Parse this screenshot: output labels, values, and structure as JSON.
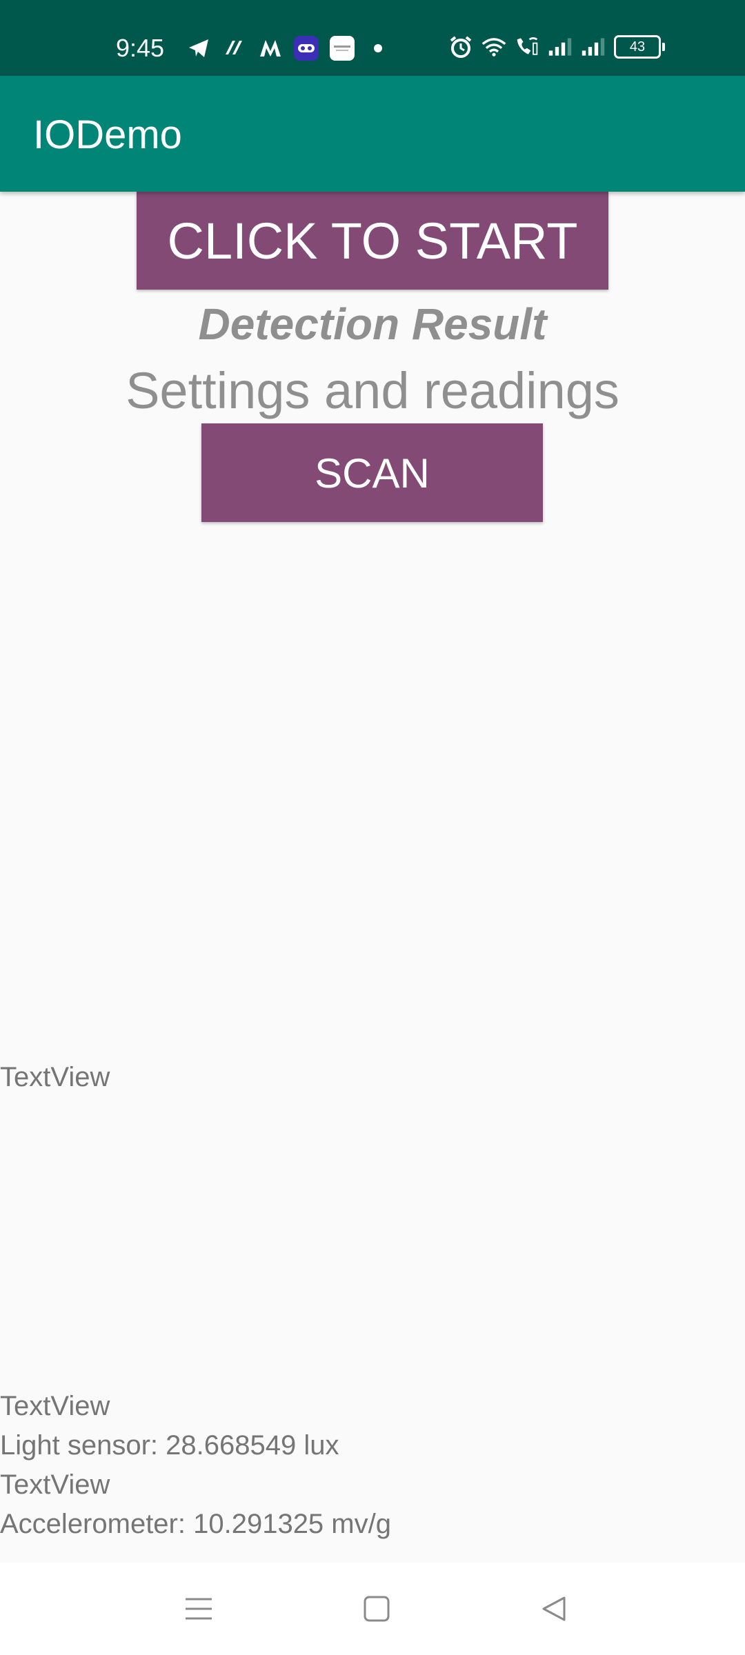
{
  "status_bar": {
    "time": "9:45",
    "battery": "43",
    "icons_left": [
      "telegram-icon",
      "app-icon",
      "myntra-icon",
      "gaming-icon",
      "notification-app-icon",
      "dot-icon"
    ],
    "icons_right": [
      "alarm-icon",
      "wifi-icon",
      "wifi-calling-icon",
      "signal-1-icon",
      "signal-2-icon",
      "battery-icon"
    ]
  },
  "app_bar": {
    "title": "IODemo"
  },
  "main": {
    "start_button": "CLICK TO START",
    "detection_result": "Detection Result",
    "settings_text": "Settings and readings",
    "scan_button": "SCAN",
    "textview_1": "TextView",
    "textview_2": "TextView",
    "light_sensor": "Light sensor: 28.668549 lux",
    "textview_3": "TextView",
    "accelerometer": "Accelerometer: 10.291325 mv/g"
  },
  "nav_bar": {
    "items": [
      "menu-icon",
      "home-icon",
      "back-icon"
    ]
  },
  "colors": {
    "status_bar": "#00574b",
    "app_bar": "#008577",
    "button": "#834a75",
    "background": "#fafafa",
    "muted_text": "#8f8f8f"
  }
}
